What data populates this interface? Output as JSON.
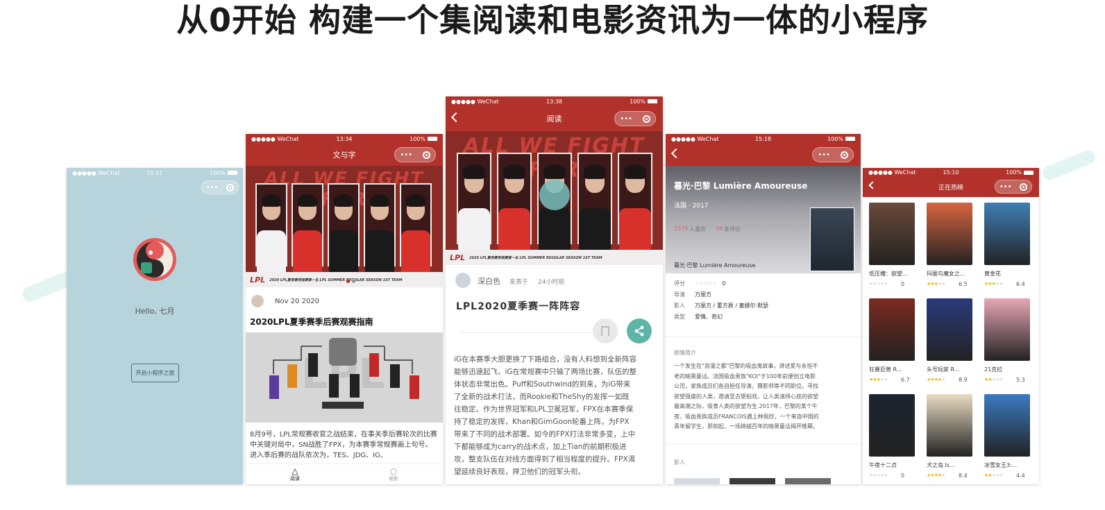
{
  "headline": "从0开始 构建一个集阅读和电影资讯为一体的小程序",
  "colors": {
    "brand_red": "#b2322b",
    "teal": "#5fb4a8",
    "welcome_bg": "#b7d3db"
  },
  "status_bar": {
    "carrier": "●●●●● WeChat",
    "battery": "100%"
  },
  "phone1": {
    "time": "15:11",
    "greeting": "Hello, 七月",
    "enter_button": "开启小程序之旅"
  },
  "phone2": {
    "time": "13:34",
    "nav_title": "文与字",
    "banner_caption": "2020 LPL夏季赛常规赛第一名 LPL SUMMER REGULAR SEASON 1ST TEAM",
    "banner_logo": "LPL",
    "post_date": "Nov 20 2020",
    "post_title": "2020LPL夏季赛季后赛观赛指南",
    "post_excerpt": "8月9号，LPL常规赛收官之战结束，在事关季后赛轮次的比赛中关键对局中，SN战胜了FPX，为本赛季常规赛画上句号。进入季后赛的战队依次为，TES、JDG、IG、",
    "tabs": [
      {
        "label": "阅读",
        "icon": "triangle-icon"
      },
      {
        "label": "电影",
        "icon": "circle-icon"
      }
    ]
  },
  "phone3": {
    "time": "13:38",
    "nav_title": "阅读",
    "banner_caption": "2020 LPL夏季赛常规赛第一名 LPL SUMMER REGULAR SEASON 1ST TEAM",
    "banner_logo": "LPL",
    "author": "深白色",
    "published_label": "发表于",
    "published_time": "24小时前",
    "article_title": "LPL2020夏季赛一阵阵容",
    "article_body": [
      "iG在本赛季大胆更换了下路组合，没有人料想到全新阵容",
      "能够迅速起飞，iG在常规赛中只输了两场比赛，队伍的整",
      "体状态非常出色。Puff和Southwind的到来，为iG带来",
      "了全新的战术打法，而Rookie和TheShy的发挥一如既",
      "往稳定。作为世界冠军和LPL卫冕冠军，FPX在本赛季保",
      "持了稳定的发挥，Khan和GimGoon轮番上阵，为FPX",
      "带来了不同的战术部署。如今的FPX打法非常多变，上中",
      "下都能够成为carry的战术点，加上Tian的前期积极进",
      "攻，整支队伍在对线方面得到了相当程度的提升。FPX渴",
      "望延续良好表现，捍卫他们的冠军头衔。"
    ]
  },
  "phone4": {
    "time": "15:18",
    "movie_title": "暮光·巴黎 Lumière Amoureuse",
    "country_year": "法国 · 2017",
    "likes_count": "2379",
    "likes_label": "人喜欢",
    "comments_count": "34",
    "comments_label": "条评论",
    "original_title": "暮光·巴黎 Lumière Amoureuse",
    "info": [
      {
        "label": "评分",
        "value": "0",
        "stars": "☆☆☆☆☆"
      },
      {
        "label": "导演",
        "value": "万丽方"
      },
      {
        "label": "影人",
        "value": "万丽方 / 董方辰 / 塞娜尔·默瑟"
      },
      {
        "label": "类型",
        "value": "爱情、奇幻"
      }
    ],
    "summary_heading": "剧情简介",
    "summary_lines": [
      "一个发生在\"浪漫之都\"巴黎的吸血鬼故事，讲述爱与永恒不",
      "老的暗黑童话。法国吸血贵族\"KOI\"于100年前便创立电影",
      "公司，家族成员们各自担任导演，摄影师等不同职位。寻找",
      "欲望强盛的人类，邀请至古堡拍戏，让人类演绎心底的欲望",
      "最高潮之际，吸食人类的欲望为生.2017年，巴黎的某个午",
      "夜，吸血贵族成员FRANCOIS遇上林佩欣，一个来自中国的",
      "青年留学生，那刻起，一场跨越百年的暗黑童话揭开帷幕。"
    ],
    "cast_heading": "影人"
  },
  "phone5": {
    "time": "15:10",
    "nav_title": "正在热映",
    "movies": [
      {
        "title": "低压槽：欲望...",
        "score": "0",
        "rating": 0,
        "poster": "#6b4a3a"
      },
      {
        "title": "玛丽与魔女之...",
        "score": "6.5",
        "rating": 3,
        "poster": "#d8653f"
      },
      {
        "title": "黄金花",
        "score": "6.4",
        "rating": 3,
        "poster": "#3e7fb5"
      },
      {
        "title": "狂暴巨兽 R...",
        "score": "6.7",
        "rating": 3,
        "poster": "#7a2a1e"
      },
      {
        "title": "头号玩家 R...",
        "score": "8.9",
        "rating": 4,
        "poster": "#2a3a7a"
      },
      {
        "title": "21克拉",
        "score": "5.3",
        "rating": 2,
        "poster": "#e7a6b5"
      },
      {
        "title": "午夜十二点",
        "score": "0",
        "rating": 0,
        "poster": "#1c2530"
      },
      {
        "title": "犬之岛 Is...",
        "score": "8.4",
        "rating": 4,
        "poster": "#e9dcc2"
      },
      {
        "title": "冰雪女王3:...",
        "score": "4.4",
        "rating": 2,
        "poster": "#3a7bc0"
      }
    ]
  }
}
